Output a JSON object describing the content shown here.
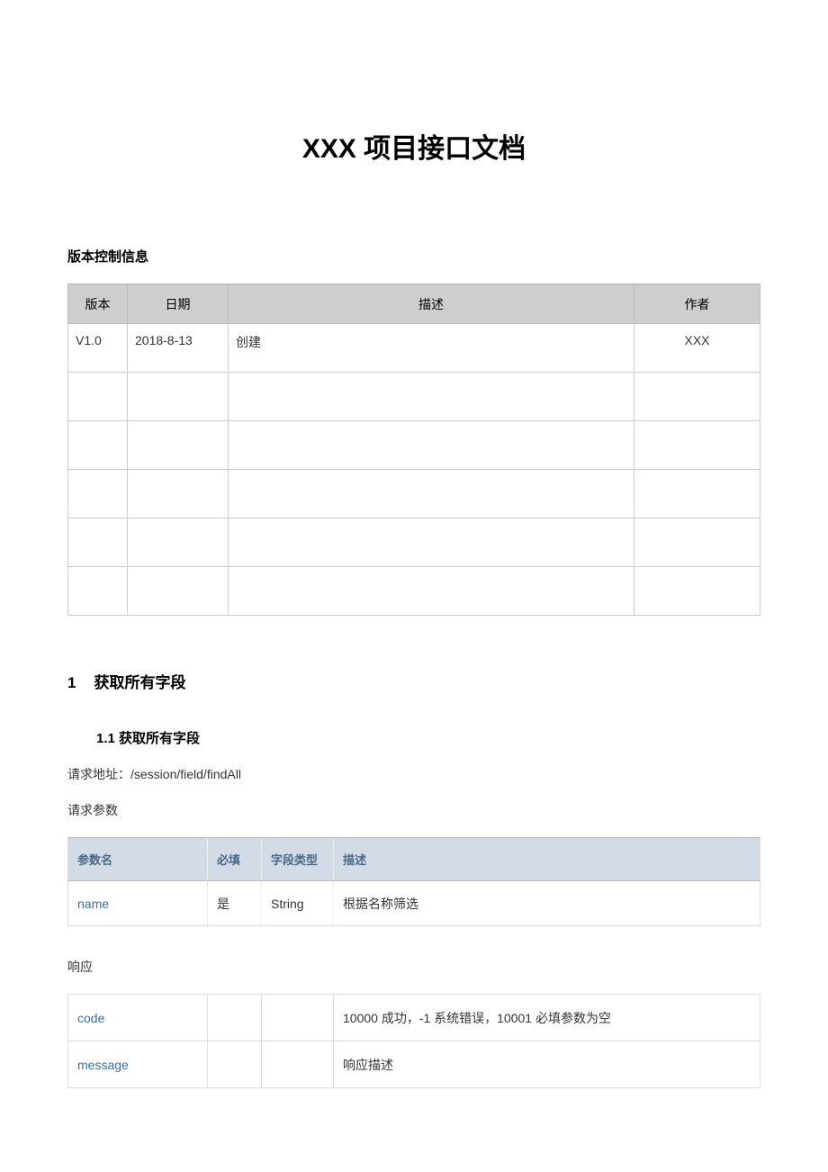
{
  "title": "XXX 项目接口文档",
  "version_section_label": "版本控制信息",
  "version_table": {
    "headers": [
      "版本",
      "日期",
      "描述",
      "作者"
    ],
    "rows": [
      {
        "version": "V1.0",
        "date": "2018-8-13",
        "desc": "创建",
        "author": "XXX"
      },
      {
        "version": "",
        "date": "",
        "desc": "",
        "author": ""
      },
      {
        "version": "",
        "date": "",
        "desc": "",
        "author": ""
      },
      {
        "version": "",
        "date": "",
        "desc": "",
        "author": ""
      },
      {
        "version": "",
        "date": "",
        "desc": "",
        "author": ""
      },
      {
        "version": "",
        "date": "",
        "desc": "",
        "author": ""
      }
    ]
  },
  "section1": {
    "number": "1",
    "title": "获取所有字段",
    "sub": {
      "number": "1.1",
      "title": "获取所有字段"
    }
  },
  "request_url_label": "请求地址：",
  "request_url": "/session/field/findAll",
  "request_params_label": "请求参数",
  "param_table": {
    "headers": [
      "参数名",
      "必填",
      "字段类型",
      "描述"
    ],
    "rows": [
      {
        "name": "name",
        "required": "是",
        "type": "String",
        "desc": "根据名称筛选"
      }
    ]
  },
  "response_label": "响应",
  "response_table": {
    "rows": [
      {
        "name": "code",
        "b": "",
        "c": "",
        "desc": "10000 成功，-1 系统错误，10001 必填参数为空"
      },
      {
        "name": "message",
        "b": "",
        "c": "",
        "desc": "响应描述"
      }
    ]
  }
}
